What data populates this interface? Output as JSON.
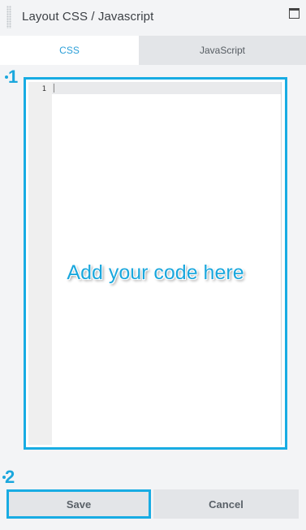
{
  "panel": {
    "title": "Layout CSS / Javascript",
    "drag_handle_icon": "grip-dots-icon",
    "window_icon": "window-maximize-icon"
  },
  "tabs": [
    {
      "label": "CSS",
      "active": true
    },
    {
      "label": "JavaScript",
      "active": false
    }
  ],
  "editor": {
    "line_numbers": [
      "1"
    ],
    "content": "",
    "hint": "Add your code here"
  },
  "markers": [
    "1",
    "2"
  ],
  "buttons": {
    "save": "Save",
    "cancel": "Cancel"
  },
  "colors": {
    "accent": "#18ace3",
    "active_tab_text": "#2b9fd8",
    "background": "#f3f4f6",
    "button_bg": "#e3e5e8"
  }
}
